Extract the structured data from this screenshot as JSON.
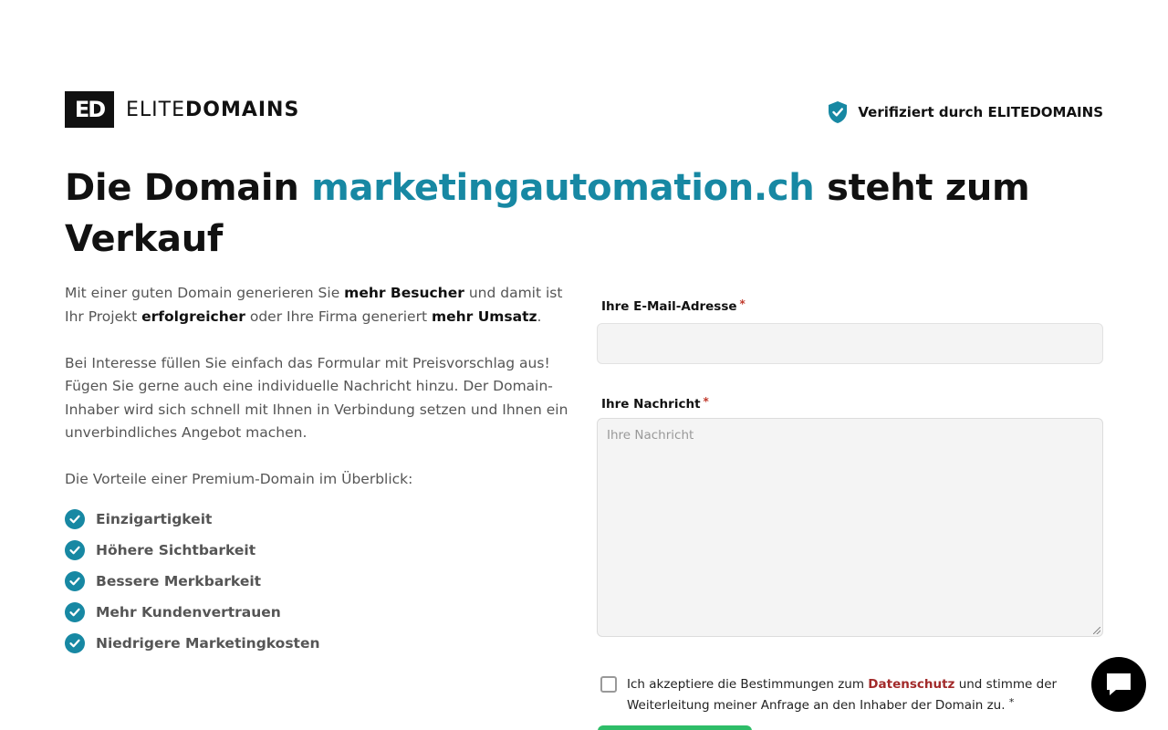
{
  "brand": {
    "logo_mark": "ED",
    "name_light": "ELITE",
    "name_bold": "DOMAINS"
  },
  "verified": {
    "text": "Verifiziert durch ELITEDOMAINS",
    "icon": "shield-check-icon"
  },
  "headline": {
    "before": "Die Domain ",
    "domain": "marketingautomation.ch",
    "after": " steht zum Verkauf"
  },
  "intro": {
    "p1": [
      {
        "t": "Mit einer guten Domain generieren Sie ",
        "b": false
      },
      {
        "t": "mehr Besucher",
        "b": true
      },
      {
        "t": " und damit ist Ihr Projekt ",
        "b": false
      },
      {
        "t": "erfolgreicher",
        "b": true
      },
      {
        "t": " oder Ihre Firma generiert ",
        "b": false
      },
      {
        "t": "mehr Umsatz",
        "b": true
      },
      {
        "t": ".",
        "b": false
      }
    ],
    "p2": "Bei Interesse füllen Sie einfach das Formular mit Preisvorschlag aus! Fügen Sie gerne auch eine individuelle Nachricht hinzu. Der Domain-Inhaber wird sich schnell mit Ihnen in Verbindung setzen und Ihnen ein unverbindliches Angebot machen.",
    "p3": "Die Vorteile einer Premium-Domain im Überblick:"
  },
  "benefits": [
    "Einzigartigkeit",
    "Höhere Sichtbarkeit",
    "Bessere Merkbarkeit",
    "Mehr Kundenvertrauen",
    "Niedrigere Marketingkosten"
  ],
  "form": {
    "email_label": "Ihre E-Mail-Adresse",
    "email_value": "",
    "message_label": "Ihre Nachricht",
    "message_placeholder": "Ihre Nachricht",
    "required_mark": "*"
  },
  "consent": {
    "before": "Ich akzeptiere die Bestimmungen zum ",
    "link": "Datenschutz",
    "after": " und stimme der Weiterleitung meiner Anfrage an den Inhaber der Domain zu. ",
    "required_mark": "*",
    "checked": false
  },
  "colors": {
    "accent": "#1788a3",
    "link": "#a22a2a",
    "submit": "#2ebd68"
  }
}
